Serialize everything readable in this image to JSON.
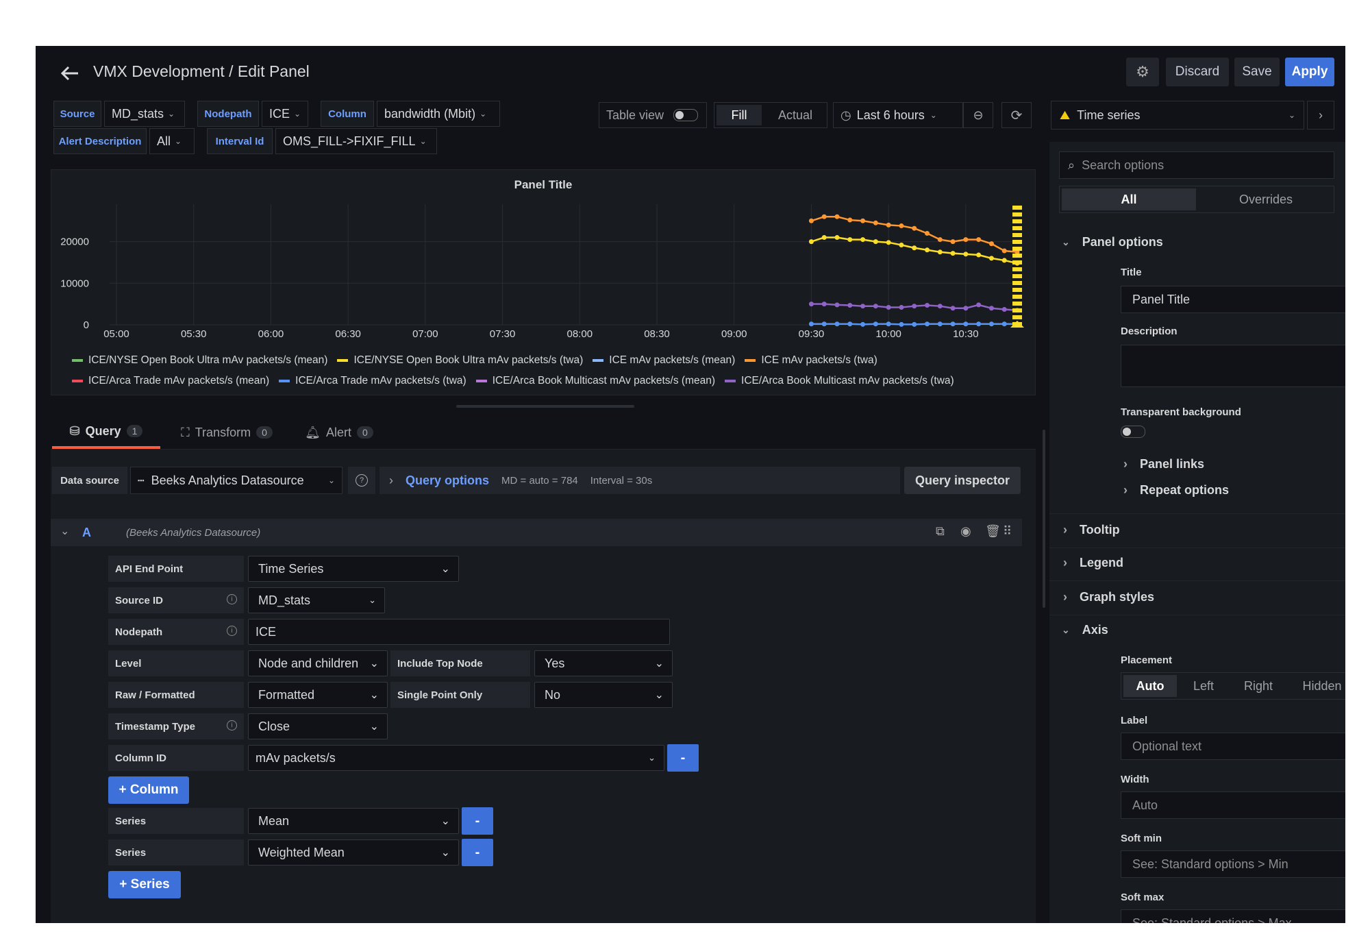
{
  "header": {
    "title": "VMX Development / Edit Panel",
    "discard": "Discard",
    "save": "Save",
    "apply": "Apply"
  },
  "variables": [
    {
      "label": "Source",
      "value": "MD_stats"
    },
    {
      "label": "Nodepath",
      "value": "ICE"
    },
    {
      "label": "Column",
      "value": "bandwidth (Mbit)"
    },
    {
      "label": "Alert Description",
      "value": "All"
    },
    {
      "label": "Interval Id",
      "value": "OMS_FILL->FIXIF_FILL"
    }
  ],
  "toolbar": {
    "table_view": "Table view",
    "fill": "Fill",
    "actual": "Actual",
    "time_range": "Last 6 hours",
    "visualization": "Time series"
  },
  "chart_data": {
    "type": "line",
    "title": "Panel Title",
    "x": [
      "09:30",
      "09:35",
      "09:40",
      "09:45",
      "09:50",
      "09:55",
      "10:00",
      "10:05",
      "10:10",
      "10:15",
      "10:20",
      "10:25",
      "10:30",
      "10:35",
      "10:40",
      "10:45",
      "10:50"
    ],
    "xticks": [
      "05:00",
      "05:30",
      "06:00",
      "06:30",
      "07:00",
      "07:30",
      "08:00",
      "08:30",
      "09:00",
      "09:30",
      "10:00",
      "10:30"
    ],
    "yticks": [
      "0",
      "10000",
      "20000"
    ],
    "ylim": [
      0,
      29000
    ],
    "series": [
      {
        "name": "ICE/NYSE Open Book Ultra mAv packets/s (mean)",
        "color": "#73bf69",
        "values": []
      },
      {
        "name": "ICE/NYSE Open Book Ultra mAv packets/s (twa)",
        "color": "#fade2a",
        "values": [
          20000,
          21000,
          21000,
          20500,
          20500,
          20000,
          19800,
          19200,
          18500,
          18000,
          17500,
          17200,
          17000,
          16800,
          16000,
          15500,
          14800
        ]
      },
      {
        "name": "ICE mAv packets/s (mean)",
        "color": "#8ab8ff",
        "values": []
      },
      {
        "name": "ICE mAv packets/s (twa)",
        "color": "#ff9830",
        "values": [
          25000,
          26000,
          26000,
          25200,
          25000,
          24500,
          24000,
          23800,
          23200,
          22000,
          20500,
          20000,
          20500,
          20500,
          19500,
          17800,
          17500
        ]
      },
      {
        "name": "ICE/Arca Trade mAv packets/s (mean)",
        "color": "#f2495c",
        "values": []
      },
      {
        "name": "ICE/Arca Trade mAv packets/s (twa)",
        "color": "#5794f2",
        "values": [
          200,
          200,
          200,
          200,
          100,
          200,
          200,
          100,
          100,
          200,
          200,
          200,
          200,
          200,
          200,
          200,
          200
        ]
      },
      {
        "name": "ICE/Arca Book Multicast mAv packets/s (mean)",
        "color": "#b877d9",
        "values": []
      },
      {
        "name": "ICE/Arca Book Multicast mAv packets/s (twa)",
        "color": "#8f63c8",
        "values": [
          5000,
          5000,
          4800,
          4700,
          4500,
          4500,
          4200,
          4200,
          4500,
          4700,
          4500,
          4000,
          4000,
          4800,
          4000,
          3700,
          3500
        ]
      }
    ]
  },
  "tabs": [
    {
      "label": "Query",
      "count": "1"
    },
    {
      "label": "Transform",
      "count": "0"
    },
    {
      "label": "Alert",
      "count": "0"
    }
  ],
  "query": {
    "data_source_label": "Data source",
    "data_source": "Beeks Analytics Datasource",
    "query_options": "Query options",
    "md": "MD = auto = 784",
    "interval": "Interval = 30s",
    "inspector": "Query inspector",
    "ref_id": "A",
    "ref_source": "(Beeks Analytics Datasource)",
    "fields": {
      "api_end_point": {
        "label": "API End Point",
        "value": "Time Series"
      },
      "source_id": {
        "label": "Source ID",
        "value": "MD_stats"
      },
      "nodepath": {
        "label": "Nodepath",
        "value": "ICE"
      },
      "level": {
        "label": "Level",
        "value": "Node and children"
      },
      "include_top_node": {
        "label": "Include Top Node",
        "value": "Yes"
      },
      "raw_formatted": {
        "label": "Raw / Formatted",
        "value": "Formatted"
      },
      "single_point_only": {
        "label": "Single Point Only",
        "value": "No"
      },
      "timestamp_type": {
        "label": "Timestamp Type",
        "value": "Close"
      },
      "column_id": {
        "label": "Column ID",
        "value": "mAv packets/s"
      },
      "series1": {
        "label": "Series",
        "value": "Mean"
      },
      "series2": {
        "label": "Series",
        "value": "Weighted Mean"
      }
    },
    "add_column": "+ Column",
    "add_series": "+ Series",
    "minus": "-"
  },
  "sidebar": {
    "search_placeholder": "Search options",
    "tab_all": "All",
    "tab_overrides": "Overrides",
    "panel_options": "Panel options",
    "title_label": "Title",
    "title_value": "Panel Title",
    "description_label": "Description",
    "transparent_label": "Transparent background",
    "panel_links": "Panel links",
    "repeat_options": "Repeat options",
    "tooltip": "Tooltip",
    "legend": "Legend",
    "graph_styles": "Graph styles",
    "axis": "Axis",
    "placement_label": "Placement",
    "placement_options": [
      "Auto",
      "Left",
      "Right",
      "Hidden"
    ],
    "label_label": "Label",
    "label_placeholder": "Optional text",
    "width_label": "Width",
    "width_placeholder": "Auto",
    "soft_min_label": "Soft min",
    "soft_min_placeholder": "See: Standard options > Min",
    "soft_max_label": "Soft max",
    "soft_max_placeholder": "See: Standard options > Max"
  }
}
